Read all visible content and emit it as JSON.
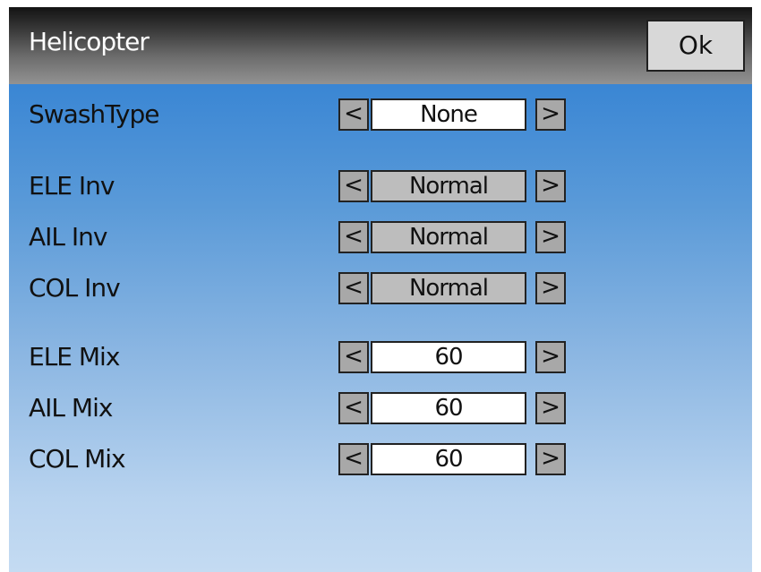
{
  "header": {
    "title": "Helicopter",
    "ok_label": "Ok"
  },
  "rows": [
    {
      "label": "SwashType",
      "value": "None",
      "style": "white"
    },
    {
      "label": "ELE Inv",
      "value": "Normal",
      "style": "grey"
    },
    {
      "label": "AIL Inv",
      "value": "Normal",
      "style": "grey"
    },
    {
      "label": "COL Inv",
      "value": "Normal",
      "style": "grey"
    },
    {
      "label": "ELE Mix",
      "value": "60",
      "style": "white"
    },
    {
      "label": "AIL Mix",
      "value": "60",
      "style": "white"
    },
    {
      "label": "COL Mix",
      "value": "60",
      "style": "white"
    }
  ],
  "arrows": {
    "left": "<",
    "right": ">"
  },
  "colors": {
    "content_top": "#3a86d4",
    "content_bottom": "#c4dbf2",
    "value_bg_white": "#ffffff",
    "value_bg_grey": "#bdbdbd"
  }
}
